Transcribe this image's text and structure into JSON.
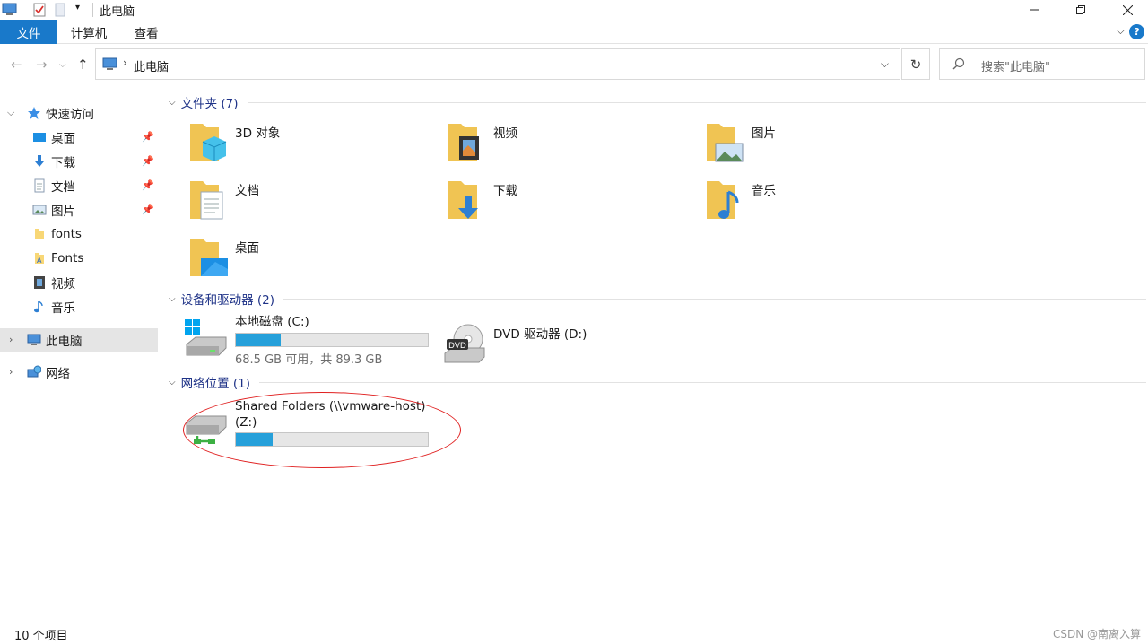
{
  "window": {
    "title": "此电脑"
  },
  "ribbon": {
    "tabs": [
      "文件",
      "计算机",
      "查看"
    ],
    "help": "?"
  },
  "nav": {
    "location": "此电脑",
    "search_placeholder": "搜索\"此电脑\""
  },
  "sidebar": {
    "quick_access": "快速访问",
    "items": [
      {
        "label": "桌面",
        "icon": "desktop-icon",
        "pinned": true
      },
      {
        "label": "下载",
        "icon": "download-icon",
        "pinned": true
      },
      {
        "label": "文档",
        "icon": "document-icon",
        "pinned": true
      },
      {
        "label": "图片",
        "icon": "picture-icon",
        "pinned": true
      },
      {
        "label": "fonts",
        "icon": "folder-icon",
        "pinned": false
      },
      {
        "label": "Fonts",
        "icon": "fonts-folder-icon",
        "pinned": false
      },
      {
        "label": "视频",
        "icon": "video-icon",
        "pinned": false
      },
      {
        "label": "音乐",
        "icon": "music-icon",
        "pinned": false
      }
    ],
    "this_pc": "此电脑",
    "network": "网络"
  },
  "groups": {
    "folders": {
      "header": "文件夹 (7)",
      "items": [
        "3D 对象",
        "视频",
        "图片",
        "文档",
        "下载",
        "音乐",
        "桌面"
      ]
    },
    "devices": {
      "header": "设备和驱动器 (2)",
      "local_disk": {
        "label": "本地磁盘 (C:)",
        "info": "68.5 GB 可用，共 89.3 GB",
        "used_fraction": 0.233
      },
      "dvd": {
        "label": "DVD 驱动器 (D:)",
        "badge": "DVD"
      }
    },
    "network": {
      "header": "网络位置 (1)",
      "shared": {
        "label": "Shared Folders (\\\\vmware-host) (Z:)",
        "used_fraction": 0.19
      }
    }
  },
  "status": {
    "count": "10 个项目",
    "watermark": "CSDN @南离入算"
  },
  "colors": {
    "accent": "#1979ca",
    "progress": "#26a0da",
    "group_header": "#1e3287",
    "annotation": "#e02020"
  }
}
